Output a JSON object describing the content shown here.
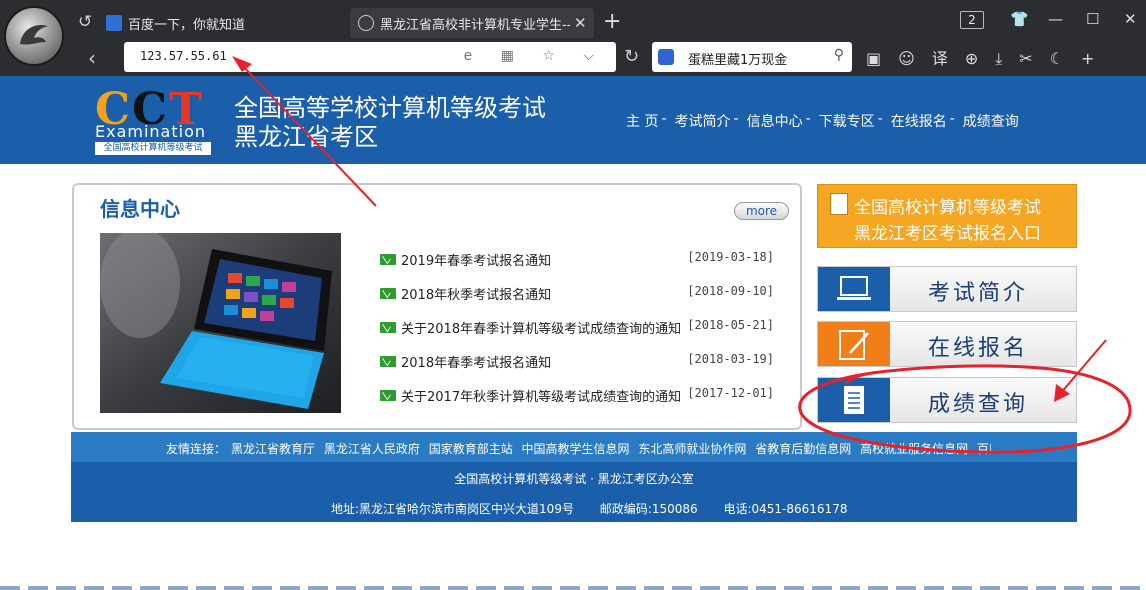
{
  "browser": {
    "tabs": [
      {
        "title": "百度一下，你就知道",
        "active": false
      },
      {
        "title": "黑龙江省高校非计算机专业学生--计",
        "active": true
      }
    ],
    "tab_count": "2",
    "address": "123.57.55.61",
    "search_query": "蛋糕里藏1万现金",
    "translate_label": "译"
  },
  "site": {
    "logo_text": "CCT",
    "logo_sub": "Examination",
    "logo_tag": "全国高校计算机等级考试",
    "title_line1": "全国高等学校计算机等级考试",
    "title_line2": "黑龙江省考区",
    "nav": [
      "主 页",
      "考试简介",
      "信息中心",
      "下载专区",
      "在线报名",
      "成绩查询"
    ],
    "nav_sep": "-"
  },
  "info_center": {
    "title": "信息中心",
    "more_label": "more",
    "news": [
      {
        "title": "2019年春季考试报名通知",
        "date": "[2019-03-18]"
      },
      {
        "title": "2018年秋季考试报名通知",
        "date": "[2018-09-10]"
      },
      {
        "title": "关于2018年春季计算机等级考试成绩查询的通知",
        "date": "[2018-05-21]"
      },
      {
        "title": "2018年春季考试报名通知",
        "date": "[2018-03-19]"
      },
      {
        "title": "关于2017年秋季计算机等级考试成绩查询的通知",
        "date": "[2017-12-01]"
      }
    ]
  },
  "side": {
    "banner_line1": "全国高校计算机等级考试",
    "banner_line2": "黑龙江考区考试报名入口",
    "buttons": [
      {
        "label": "考试简介",
        "color": "#1b5ea9"
      },
      {
        "label": "在线报名",
        "color": "#f07f1a"
      },
      {
        "label": "成绩查询",
        "color": "#1b5ea9"
      }
    ]
  },
  "links": {
    "label": "友情连接：",
    "items": [
      "黑龙江省教育厅",
      "黑龙江省人民政府",
      "国家教育部主站",
      "中国高教学生信息网",
      "东北高师就业协作网",
      "省教育后勤信息网",
      "高校就业服务信息网",
      "百度"
    ]
  },
  "footer": {
    "org": "全国高校计算机等级考试 · 黑龙江考区办公室",
    "address": "地址:黑龙江省哈尔滨市南岗区中兴大道109号",
    "postcode": "邮政编码:150086",
    "phone": "电话:0451-86616178"
  },
  "colors": {
    "brand_blue": "#1b5ea9",
    "banner_orange": "#f5a623",
    "annotation_red": "#e8222a"
  }
}
